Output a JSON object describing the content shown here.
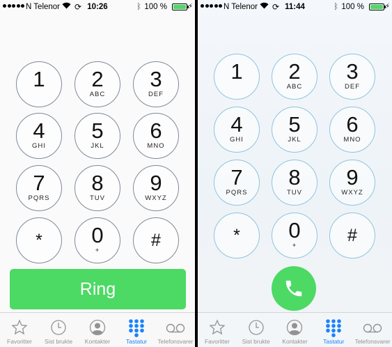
{
  "status_left": {
    "carrier": "N Telenor",
    "time": "10:26",
    "battery": "100 %",
    "battery_level": 1.0
  },
  "status_right": {
    "carrier": "N Telenor",
    "time": "11:44",
    "battery": "100 %",
    "battery_level": 1.0
  },
  "keypad": [
    {
      "digit": "1",
      "letters": ""
    },
    {
      "digit": "2",
      "letters": "ABC"
    },
    {
      "digit": "3",
      "letters": "DEF"
    },
    {
      "digit": "4",
      "letters": "GHI"
    },
    {
      "digit": "5",
      "letters": "JKL"
    },
    {
      "digit": "6",
      "letters": "MNO"
    },
    {
      "digit": "7",
      "letters": "PQRS"
    },
    {
      "digit": "8",
      "letters": "TUV"
    },
    {
      "digit": "9",
      "letters": "WXYZ"
    },
    {
      "digit": "*",
      "letters": ""
    },
    {
      "digit": "0",
      "letters": "+"
    },
    {
      "digit": "#",
      "letters": ""
    }
  ],
  "call_left_label": "Ring",
  "tabs": [
    {
      "label": "Favoritter",
      "icon": "star-icon"
    },
    {
      "label": "Sist brukte",
      "icon": "clock-icon"
    },
    {
      "label": "Kontakter",
      "icon": "contact-icon"
    },
    {
      "label": "Tastatur",
      "icon": "keypad-icon",
      "active": true
    },
    {
      "label": "Telefonsvarer",
      "icon": "voicemail-icon"
    }
  ],
  "colors": {
    "call_green": "#4cd964",
    "active_tab": "#1a82fb",
    "inactive_tab": "#929292"
  }
}
